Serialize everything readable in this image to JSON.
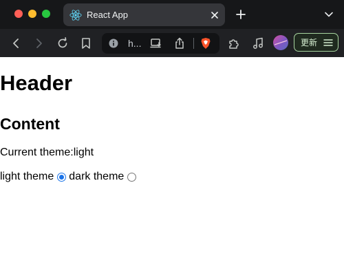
{
  "browser": {
    "tab": {
      "title": "React App",
      "favicon": "react-icon"
    },
    "omnibox": {
      "text": "h..."
    },
    "update_button": {
      "label": "更新"
    },
    "icons": {
      "back": "back-arrow-icon",
      "forward": "forward-arrow-icon",
      "reload": "reload-icon",
      "bookmark": "bookmark-icon",
      "site_info": "info-icon",
      "install": "install-app-icon",
      "share": "share-icon",
      "brave": "brave-shields-icon",
      "extensions": "extensions-icon",
      "media": "music-note-icon",
      "menu": "hamburger-menu-icon",
      "tab_list": "chevron-down-icon",
      "new_tab": "plus-icon",
      "close_tab": "close-icon"
    },
    "colors": {
      "traffic_red": "#ff5f57",
      "traffic_yellow": "#febc2e",
      "traffic_green": "#28c840",
      "update_border": "#a8d5a0",
      "brave_orange": "#fb542b"
    }
  },
  "page": {
    "header": "Header",
    "subheader": "Content",
    "current_theme_label": "Current theme:",
    "current_theme_value": "light",
    "options": [
      {
        "label": "light theme",
        "checked": true
      },
      {
        "label": "dark theme",
        "checked": false
      }
    ],
    "accent_color": "#1a73e8"
  }
}
